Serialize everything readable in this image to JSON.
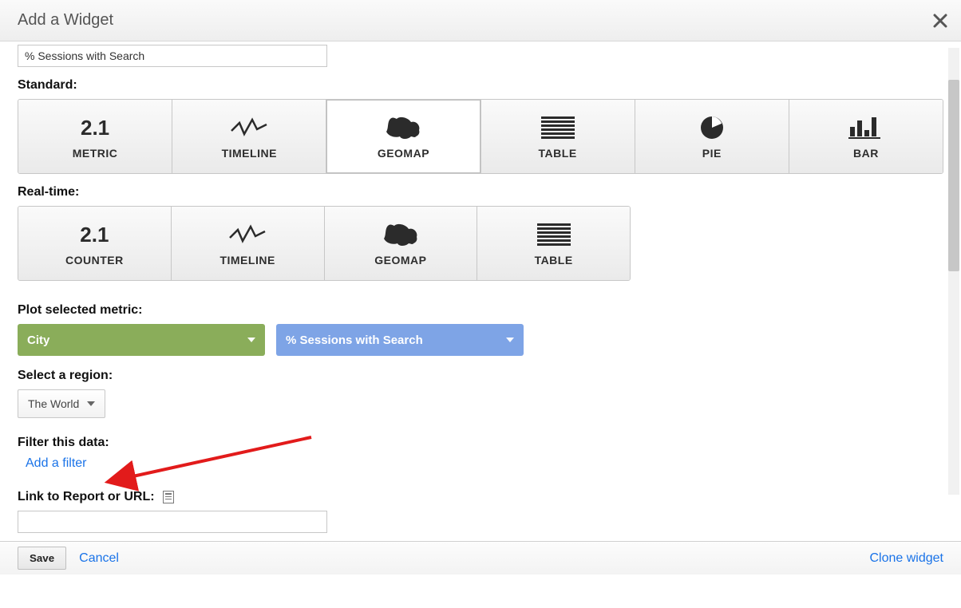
{
  "title": "Add a Widget",
  "name_input_value": "% Sessions with Search",
  "standard_label": "Standard:",
  "realtime_label": "Real-time:",
  "standard_tiles": [
    {
      "id": "metric",
      "label": "METRIC"
    },
    {
      "id": "timeline",
      "label": "TIMELINE"
    },
    {
      "id": "geomap",
      "label": "GEOMAP"
    },
    {
      "id": "table",
      "label": "TABLE"
    },
    {
      "id": "pie",
      "label": "PIE"
    },
    {
      "id": "bar",
      "label": "BAR"
    }
  ],
  "selected_standard": "geomap",
  "realtime_tiles": [
    {
      "id": "counter",
      "label": "COUNTER"
    },
    {
      "id": "timeline",
      "label": "TIMELINE"
    },
    {
      "id": "geomap",
      "label": "GEOMAP"
    },
    {
      "id": "table",
      "label": "TABLE"
    }
  ],
  "plot_label": "Plot selected metric:",
  "dimension_pill": "City",
  "metric_pill": "% Sessions with Search",
  "region_label": "Select a region:",
  "region_value": "The World",
  "filter_label": "Filter this data:",
  "add_filter": "Add a filter",
  "link_report_label": "Link to Report or URL:",
  "link_report_value": "",
  "save": "Save",
  "cancel": "Cancel",
  "clone": "Clone widget",
  "metric_num": "2.1"
}
